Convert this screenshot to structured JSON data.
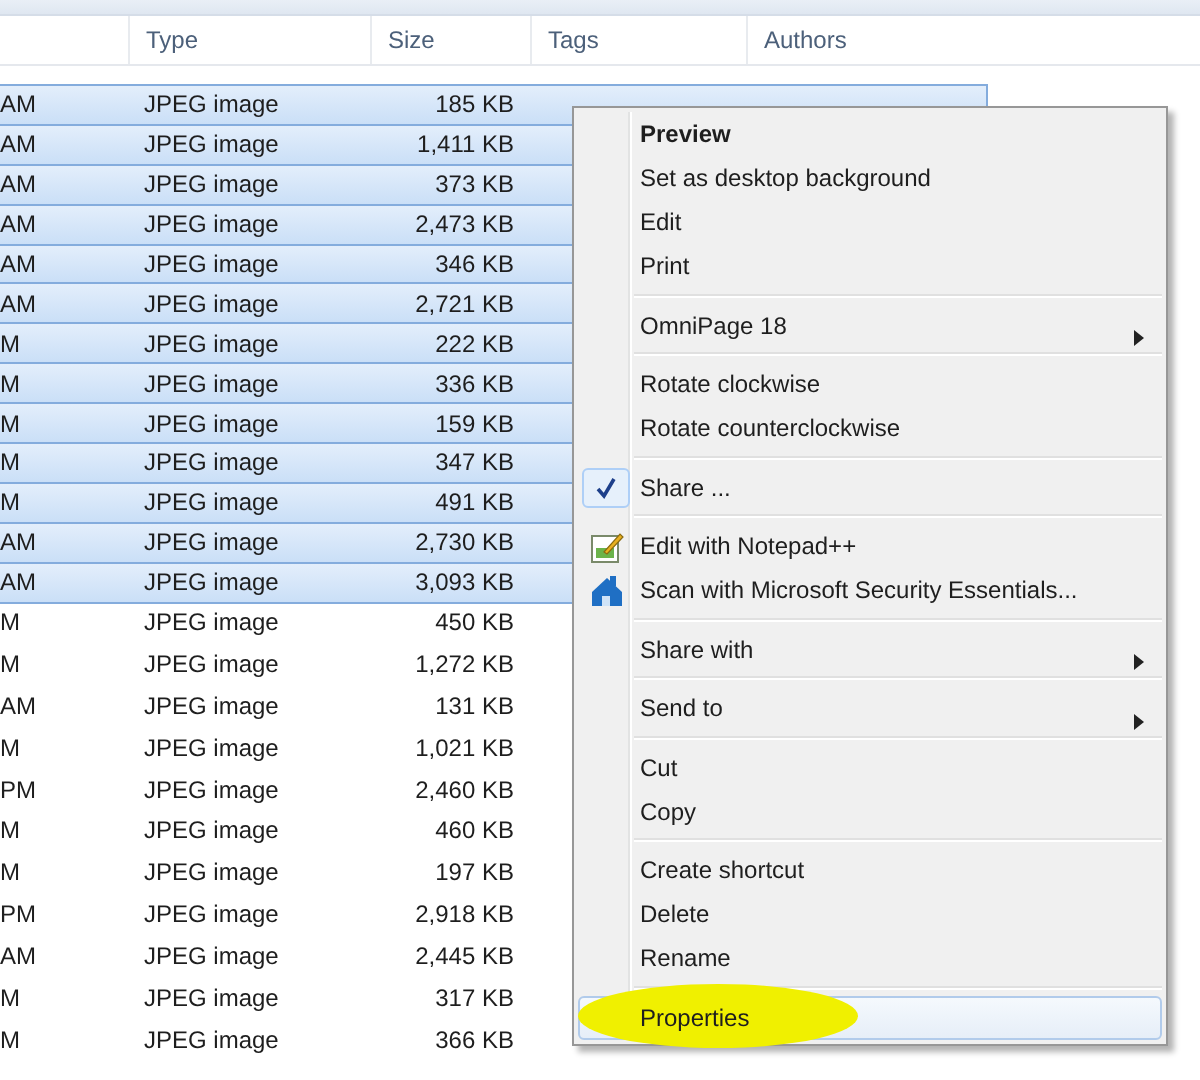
{
  "table": {
    "columns": [
      "Type",
      "Size",
      "Tags",
      "Authors"
    ],
    "rows": [
      {
        "column_1": "AM",
        "type": "JPEG image",
        "size": "185 KB",
        "selected": true
      },
      {
        "column_1": "AM",
        "type": "JPEG image",
        "size": "1,411 KB",
        "selected": true
      },
      {
        "column_1": "AM",
        "type": "JPEG image",
        "size": "373 KB",
        "selected": true
      },
      {
        "column_1": "AM",
        "type": "JPEG image",
        "size": "2,473 KB",
        "selected": true
      },
      {
        "column_1": "AM",
        "type": "JPEG image",
        "size": "346 KB",
        "selected": true
      },
      {
        "column_1": "AM",
        "type": "JPEG image",
        "size": "2,721 KB",
        "selected": true
      },
      {
        "column_1": "M",
        "type": "JPEG image",
        "size": "222 KB",
        "selected": true
      },
      {
        "column_1": "M",
        "type": "JPEG image",
        "size": "336 KB",
        "selected": true
      },
      {
        "column_1": "M",
        "type": "JPEG image",
        "size": "159 KB",
        "selected": true
      },
      {
        "column_1": "M",
        "type": "JPEG image",
        "size": "347 KB",
        "selected": true
      },
      {
        "column_1": "M",
        "type": "JPEG image",
        "size": "491 KB",
        "selected": true
      },
      {
        "column_1": "AM",
        "type": "JPEG image",
        "size": "2,730 KB",
        "selected": true
      },
      {
        "column_1": "AM",
        "type": "JPEG image",
        "size": "3,093 KB",
        "selected": true
      },
      {
        "column_1": "M",
        "type": "JPEG image",
        "size": "450 KB",
        "selected": false
      },
      {
        "column_1": "M",
        "type": "JPEG image",
        "size": "1,272 KB",
        "selected": false
      },
      {
        "column_1": "AM",
        "type": "JPEG image",
        "size": "131 KB",
        "selected": false
      },
      {
        "column_1": "M",
        "type": "JPEG image",
        "size": "1,021 KB",
        "selected": false
      },
      {
        "column_1": "PM",
        "type": "JPEG image",
        "size": "2,460 KB",
        "selected": false
      },
      {
        "column_1": "M",
        "type": "JPEG image",
        "size": "460 KB",
        "selected": false
      },
      {
        "column_1": "M",
        "type": "JPEG image",
        "size": "197 KB",
        "selected": false
      },
      {
        "column_1": "PM",
        "type": "JPEG image",
        "size": "2,918 KB",
        "selected": false
      },
      {
        "column_1": "AM",
        "type": "JPEG image",
        "size": "2,445 KB",
        "selected": false
      },
      {
        "column_1": "M",
        "type": "JPEG image",
        "size": "317 KB",
        "selected": false
      },
      {
        "column_1": "M",
        "type": "JPEG image",
        "size": "366 KB",
        "selected": false
      }
    ]
  },
  "context_menu": {
    "items": [
      {
        "kind": "item",
        "label": "Preview",
        "default": true,
        "checked": false,
        "submenu": false,
        "hovered": false,
        "highlighted": false
      },
      {
        "kind": "item",
        "label": "Set as desktop background",
        "default": false,
        "checked": false,
        "submenu": false,
        "hovered": false,
        "highlighted": false
      },
      {
        "kind": "item",
        "label": "Edit",
        "default": false,
        "checked": false,
        "submenu": false,
        "hovered": false,
        "highlighted": false
      },
      {
        "kind": "item",
        "label": "Print",
        "default": false,
        "checked": false,
        "submenu": false,
        "hovered": false,
        "highlighted": false
      },
      {
        "kind": "separator"
      },
      {
        "kind": "item",
        "label": "OmniPage 18",
        "default": false,
        "checked": false,
        "submenu": true,
        "hovered": false,
        "highlighted": false
      },
      {
        "kind": "separator"
      },
      {
        "kind": "item",
        "label": "Rotate clockwise",
        "default": false,
        "checked": false,
        "submenu": false,
        "hovered": false,
        "highlighted": false
      },
      {
        "kind": "item",
        "label": "Rotate counterclockwise",
        "default": false,
        "checked": false,
        "submenu": false,
        "hovered": false,
        "highlighted": false
      },
      {
        "kind": "separator"
      },
      {
        "kind": "item",
        "label": "Share ...",
        "default": false,
        "checked": true,
        "submenu": false,
        "hovered": false,
        "highlighted": false
      },
      {
        "kind": "separator"
      },
      {
        "kind": "app",
        "label": "Edit with Notepad++",
        "default": false,
        "checked": false,
        "submenu": false,
        "hovered": false,
        "highlighted": false
      },
      {
        "kind": "app",
        "label": "Scan with Microsoft Security Essentials...",
        "default": false,
        "checked": false,
        "submenu": false,
        "hovered": false,
        "highlighted": false
      },
      {
        "kind": "separator"
      },
      {
        "kind": "item",
        "label": "Share with",
        "default": false,
        "checked": false,
        "submenu": true,
        "hovered": false,
        "highlighted": false
      },
      {
        "kind": "separator"
      },
      {
        "kind": "item",
        "label": "Send to",
        "default": false,
        "checked": false,
        "submenu": true,
        "hovered": false,
        "highlighted": false
      },
      {
        "kind": "separator"
      },
      {
        "kind": "item",
        "label": "Cut",
        "default": false,
        "checked": false,
        "submenu": false,
        "hovered": false,
        "highlighted": false
      },
      {
        "kind": "item",
        "label": "Copy",
        "default": false,
        "checked": false,
        "submenu": false,
        "hovered": false,
        "highlighted": false
      },
      {
        "kind": "separator"
      },
      {
        "kind": "item",
        "label": "Create shortcut",
        "default": false,
        "checked": false,
        "submenu": false,
        "hovered": false,
        "highlighted": false
      },
      {
        "kind": "item",
        "label": "Delete",
        "default": false,
        "checked": false,
        "submenu": false,
        "hovered": false,
        "highlighted": false
      },
      {
        "kind": "item",
        "label": "Rename",
        "default": false,
        "checked": false,
        "submenu": false,
        "hovered": false,
        "highlighted": false
      },
      {
        "kind": "separator"
      },
      {
        "kind": "item",
        "label": "Properties",
        "default": false,
        "checked": false,
        "submenu": false,
        "hovered": true,
        "highlighted": true
      }
    ]
  }
}
